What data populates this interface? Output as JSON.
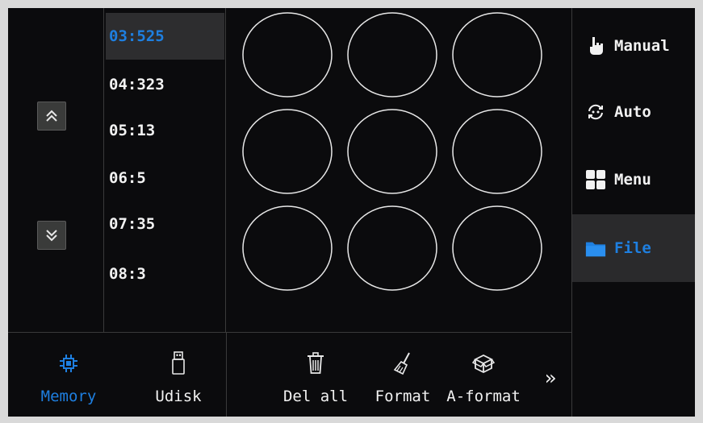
{
  "file_list": {
    "items": [
      {
        "label": "03:525",
        "selected": true
      },
      {
        "label": "04:323",
        "selected": false
      },
      {
        "label": "05:13",
        "selected": false
      },
      {
        "label": "06:5",
        "selected": false
      },
      {
        "label": "07:35",
        "selected": false
      },
      {
        "label": "08:3",
        "selected": false
      }
    ]
  },
  "navigation": {
    "scroll_up_icon": "double-chevron-up-icon",
    "scroll_down_icon": "double-chevron-down-icon"
  },
  "preview": {
    "shape": "circle",
    "rows": 3,
    "cols": 3,
    "stroke_color": "#e8e8e8"
  },
  "side_menu": {
    "items": [
      {
        "label": "Manual",
        "icon": "hand-pointer-icon",
        "active": false
      },
      {
        "label": "Auto",
        "icon": "auto-cycle-icon",
        "active": false
      },
      {
        "label": "Menu",
        "icon": "grid-menu-icon",
        "active": false
      },
      {
        "label": "File",
        "icon": "folder-icon",
        "active": true
      }
    ]
  },
  "bottom_bar": {
    "storage": [
      {
        "label": "Memory",
        "icon": "chip-icon",
        "active": true
      },
      {
        "label": "Udisk",
        "icon": "usb-drive-icon",
        "active": false
      }
    ],
    "actions": [
      {
        "label": "Del all",
        "icon": "trash-icon"
      },
      {
        "label": "Format",
        "icon": "broom-icon"
      },
      {
        "label": "A-format",
        "icon": "box-icon"
      }
    ],
    "more": "»"
  },
  "colors": {
    "accent": "#1e7fe0",
    "background": "#0b0b0d",
    "panel_selected": "#2d2d2f",
    "divider": "#3a3a3a",
    "text": "#f2f2f2"
  }
}
